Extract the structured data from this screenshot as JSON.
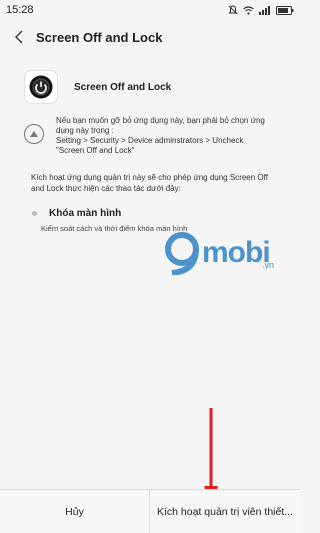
{
  "status_bar": {
    "time": "15:28"
  },
  "header": {
    "title": "Screen Off and Lock"
  },
  "app": {
    "name": "Screen Off and Lock"
  },
  "uninstall_notice": {
    "text": "Nếu bạn muốn gỡ bỏ ứng dụng này, bạn phải bỏ chọn ứng\ndụng này trong :\nSetting > Security > Device adminstrators > Uncheck\n\"Screen Off and Lock\""
  },
  "activate_description": "Kích hoạt ứng dụng quản trị này sẽ cho phép ứng dụng Screen Off and Lock thực hiện các thao tác dưới đây:",
  "permissions": [
    {
      "title": "Khóa màn hình",
      "description": "Kiểm soát cách và thời điểm khóa màn hình"
    }
  ],
  "watermark": {
    "brand": "mobi",
    "tld": ".vn"
  },
  "buttons": {
    "cancel": "Hủy",
    "activate": "Kích hoạt quản trị viên thiết..."
  },
  "colors": {
    "watermark": "#3a89c8",
    "annotation_arrow": "#e02020"
  }
}
